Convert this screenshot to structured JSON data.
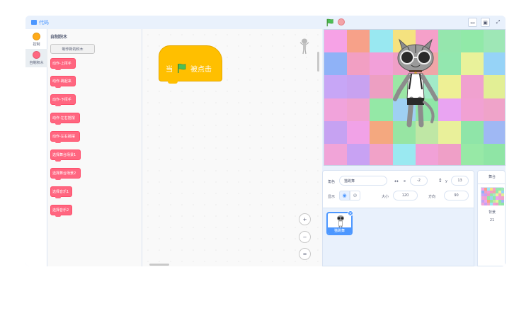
{
  "tabs": {
    "code": "代码"
  },
  "categories": [
    {
      "label": "控制",
      "color": "#ffab19"
    },
    {
      "label": "自制积木",
      "color": "#ff6680"
    }
  ],
  "palette": {
    "title": "自制积木",
    "make_block": "制作新的积木",
    "blocks": [
      "动作-上挥手",
      "动作-跳起来",
      "动作-下挥手",
      "动作-左右摇摆",
      "动作-左右摇摆",
      "选择舞台场景1",
      "选择舞台场景2",
      "选择音乐1",
      "选择音乐2"
    ]
  },
  "script": {
    "when": "当",
    "clicked": "被点击"
  },
  "zoom": {
    "in": "+",
    "out": "−",
    "reset": "="
  },
  "sprite_info": {
    "sprite_label": "角色",
    "sprite_name": "猫跳舞",
    "x_label": "x",
    "x_value": "-2",
    "y_label": "y",
    "y_value": "13",
    "show_label": "显示",
    "size_label": "大小",
    "size_value": "120",
    "direction_label": "方向",
    "direction_value": "90"
  },
  "sprite_list": [
    {
      "name": "猫跳舞"
    }
  ],
  "stage_selector": {
    "title": "舞台",
    "backdrops_label": "背景",
    "backdrops_count": "21"
  },
  "colors": {
    "accent": "#4c97ff",
    "event": "#ffbf00",
    "myblocks": "#ff6680",
    "control": "#ffab19"
  },
  "backdrop_colors": [
    "#f6a2e6",
    "#f7a189",
    "#99e8f1",
    "#f5e27f",
    "#f5a0c9",
    "#95e6ad",
    "#91e9a8",
    "#9ee7b6",
    "#8fb2f7",
    "#f29fc3",
    "#f2a0d9",
    "#ef9fc6",
    "#f0a6a8",
    "#93e7af",
    "#e9f29a",
    "#96d3f7",
    "#c7a6f6",
    "#c8a2f0",
    "#ed9fc2",
    "#9be6a5",
    "#a2eac8",
    "#eef095",
    "#f0a1cf",
    "#e2ef95",
    "#f1a3db",
    "#f1a3cf",
    "#94e8a6",
    "#9fd0f2",
    "#8fe6a7",
    "#e9a4f2",
    "#f1a1d3",
    "#efa3c9",
    "#c6a2f2",
    "#f1a2e7",
    "#f4a87f",
    "#97e5a3",
    "#bfe7a5",
    "#e9f09a",
    "#8fe5a8",
    "#9fb8f4",
    "#f1a4d8",
    "#c8a2f3",
    "#f1a2c8",
    "#9ae9f1",
    "#f1a1d7",
    "#ef9fc7",
    "#97e9a6",
    "#8fe5a5"
  ]
}
